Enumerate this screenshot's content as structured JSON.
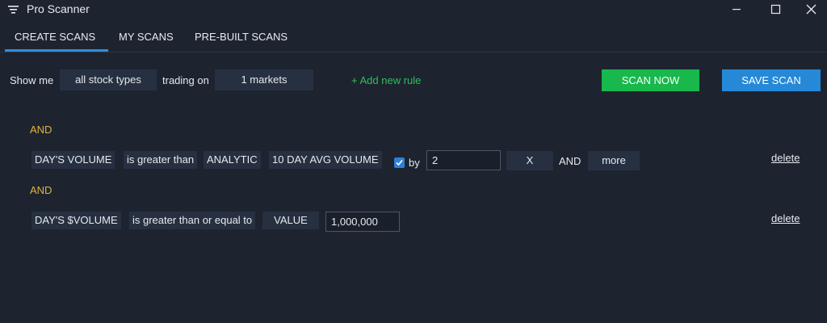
{
  "window": {
    "title": "Pro Scanner"
  },
  "tabs": [
    {
      "label": "CREATE SCANS",
      "active": true
    },
    {
      "label": "MY SCANS",
      "active": false
    },
    {
      "label": "PRE-BUILT SCANS",
      "active": false
    }
  ],
  "scan_bar": {
    "show_me": "Show me",
    "stock_types": "all stock types",
    "trading_on": "trading on",
    "markets": "1 markets",
    "add_rule": "+ Add new rule",
    "scan_now": "SCAN NOW",
    "save_scan": "SAVE SCAN"
  },
  "rules": [
    {
      "connector": "AND",
      "field": "DAY'S VOLUME",
      "operator": "is greater than",
      "compare_type": "ANALYTIC",
      "compare_field": "10 DAY AVG VOLUME",
      "by_checked": true,
      "by_label": "by",
      "by_value": "2",
      "multiplier": "X",
      "inline_and": "AND",
      "more": "more",
      "delete": "delete"
    },
    {
      "connector": "AND",
      "field": "DAY'S $VOLUME",
      "operator": "is greater than or equal to",
      "compare_type": "VALUE",
      "value": "1,000,000",
      "delete": "delete"
    }
  ],
  "colors": {
    "background": "#1d2430",
    "chip": "#263040",
    "accent_tab": "#2f8fe0",
    "scan_now": "#18b84c",
    "save_scan": "#2589d8",
    "add_rule": "#2fbf5a",
    "and_label": "#e2b53a"
  },
  "icons": {
    "app": "filter-lines-icon",
    "minimize": "minimize-icon",
    "maximize": "maximize-icon",
    "close": "close-icon",
    "checkbox": "checkmark-icon"
  }
}
